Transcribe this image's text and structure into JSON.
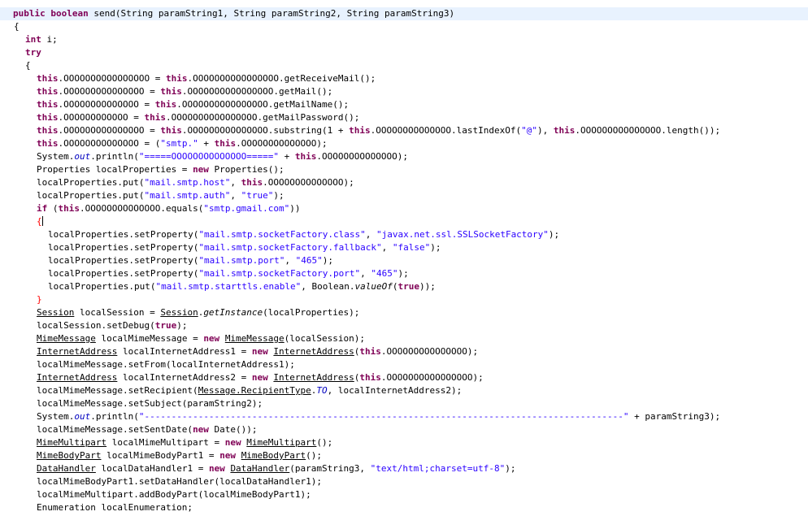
{
  "editor": {
    "lines": [
      [
        {
          "t": "public",
          "c": "kw"
        },
        {
          "t": " "
        },
        {
          "t": "boolean",
          "c": "kw"
        },
        {
          "t": " send(String paramString1, String paramString2, String paramString3)"
        }
      ],
      [
        {
          "t": "{"
        }
      ],
      [
        {
          "t": "int",
          "c": "kw"
        },
        {
          "t": " i;"
        }
      ],
      [
        {
          "t": "try",
          "c": "kw"
        }
      ],
      [
        {
          "t": "{"
        }
      ],
      [
        {
          "t": "this",
          "c": "kw"
        },
        {
          "t": ".OOOOOOOOOOOOOOOO = "
        },
        {
          "t": "this",
          "c": "kw"
        },
        {
          "t": ".OOOOOOOOOOOOOOOO.getReceiveMail();"
        }
      ],
      [
        {
          "t": "this",
          "c": "kw"
        },
        {
          "t": ".OOOOOOOOOOOOOOO = "
        },
        {
          "t": "this",
          "c": "kw"
        },
        {
          "t": ".OOOOOOOOOOOOOOOO.getMail();"
        }
      ],
      [
        {
          "t": "this",
          "c": "kw"
        },
        {
          "t": ".OOOOOOOOOOOOOO = "
        },
        {
          "t": "this",
          "c": "kw"
        },
        {
          "t": ".OOOOOOOOOOOOOOOO.getMailName();"
        }
      ],
      [
        {
          "t": "this",
          "c": "kw"
        },
        {
          "t": ".OOOOOOOOOOOO = "
        },
        {
          "t": "this",
          "c": "kw"
        },
        {
          "t": ".OOOOOOOOOOOOOOOO.getMailPassword();"
        }
      ],
      [
        {
          "t": "this",
          "c": "kw"
        },
        {
          "t": ".OOOOOOOOOOOOOOO = "
        },
        {
          "t": "this",
          "c": "kw"
        },
        {
          "t": ".OOOOOOOOOOOOOOO.substring(1 + "
        },
        {
          "t": "this",
          "c": "kw"
        },
        {
          "t": ".OOOOOOOOOOOOOO.lastIndexOf("
        },
        {
          "t": "\"@\"",
          "c": "str"
        },
        {
          "t": "), "
        },
        {
          "t": "this",
          "c": "kw"
        },
        {
          "t": ".OOOOOOOOOOOOOOO.length());"
        }
      ],
      [
        {
          "t": "this",
          "c": "kw"
        },
        {
          "t": ".OOOOOOOOOOOOOO = ("
        },
        {
          "t": "\"smtp.\"",
          "c": "str"
        },
        {
          "t": " + "
        },
        {
          "t": "this",
          "c": "kw"
        },
        {
          "t": ".OOOOOOOOOOOOOO);"
        }
      ],
      [
        {
          "t": "System."
        },
        {
          "t": "out",
          "c": "fld"
        },
        {
          "t": ".println("
        },
        {
          "t": "\"=====OOOOOOOOOOOOOO=====\"",
          "c": "str"
        },
        {
          "t": " + "
        },
        {
          "t": "this",
          "c": "kw"
        },
        {
          "t": ".OOOOOOOOOOOOOO);"
        }
      ],
      [
        {
          "t": "Properties localProperties = "
        },
        {
          "t": "new",
          "c": "kw"
        },
        {
          "t": " Properties();"
        }
      ],
      [
        {
          "t": "localProperties.put("
        },
        {
          "t": "\"mail.smtp.host\"",
          "c": "str"
        },
        {
          "t": ", "
        },
        {
          "t": "this",
          "c": "kw"
        },
        {
          "t": ".OOOOOOOOOOOOOO);"
        }
      ],
      [
        {
          "t": "localProperties.put("
        },
        {
          "t": "\"mail.smtp.auth\"",
          "c": "str"
        },
        {
          "t": ", "
        },
        {
          "t": "\"true\"",
          "c": "str"
        },
        {
          "t": ");"
        }
      ],
      [
        {
          "t": "if",
          "c": "kw"
        },
        {
          "t": " ("
        },
        {
          "t": "this",
          "c": "kw"
        },
        {
          "t": ".OOOOOOOOOOOOOO.equals("
        },
        {
          "t": "\"smtp.gmail.com\"",
          "c": "str"
        },
        {
          "t": "))"
        }
      ],
      [
        {
          "t": "{",
          "c": "brace-hl"
        },
        {
          "t": "",
          "caret": true
        }
      ],
      [
        {
          "t": "localProperties.setProperty("
        },
        {
          "t": "\"mail.smtp.socketFactory.class\"",
          "c": "str"
        },
        {
          "t": ", "
        },
        {
          "t": "\"javax.net.ssl.SSLSocketFactory\"",
          "c": "str"
        },
        {
          "t": ");"
        }
      ],
      [
        {
          "t": "localProperties.setProperty("
        },
        {
          "t": "\"mail.smtp.socketFactory.fallback\"",
          "c": "str"
        },
        {
          "t": ", "
        },
        {
          "t": "\"false\"",
          "c": "str"
        },
        {
          "t": ");"
        }
      ],
      [
        {
          "t": "localProperties.setProperty("
        },
        {
          "t": "\"mail.smtp.port\"",
          "c": "str"
        },
        {
          "t": ", "
        },
        {
          "t": "\"465\"",
          "c": "str"
        },
        {
          "t": ");"
        }
      ],
      [
        {
          "t": "localProperties.setProperty("
        },
        {
          "t": "\"mail.smtp.socketFactory.port\"",
          "c": "str"
        },
        {
          "t": ", "
        },
        {
          "t": "\"465\"",
          "c": "str"
        },
        {
          "t": ");"
        }
      ],
      [
        {
          "t": "localProperties.put("
        },
        {
          "t": "\"mail.smtp.starttls.enable\"",
          "c": "str"
        },
        {
          "t": ", Boolean."
        },
        {
          "t": "valueOf",
          "c": "it"
        },
        {
          "t": "("
        },
        {
          "t": "true",
          "c": "kw"
        },
        {
          "t": "));"
        }
      ],
      [
        {
          "t": "}",
          "c": "brace-hl"
        }
      ],
      [
        {
          "t": "Session",
          "c": "ul"
        },
        {
          "t": " localSession = "
        },
        {
          "t": "Session",
          "c": "ul"
        },
        {
          "t": "."
        },
        {
          "t": "getInstance",
          "c": "it"
        },
        {
          "t": "(localProperties);"
        }
      ],
      [
        {
          "t": "localSession.setDebug("
        },
        {
          "t": "true",
          "c": "kw"
        },
        {
          "t": ");"
        }
      ],
      [
        {
          "t": "MimeMessage",
          "c": "ul"
        },
        {
          "t": " localMimeMessage = "
        },
        {
          "t": "new",
          "c": "kw"
        },
        {
          "t": " "
        },
        {
          "t": "MimeMessage",
          "c": "ul"
        },
        {
          "t": "(localSession);"
        }
      ],
      [
        {
          "t": "InternetAddress",
          "c": "ul"
        },
        {
          "t": " localInternetAddress1 = "
        },
        {
          "t": "new",
          "c": "kw"
        },
        {
          "t": " "
        },
        {
          "t": "InternetAddress",
          "c": "ul"
        },
        {
          "t": "("
        },
        {
          "t": "this",
          "c": "kw"
        },
        {
          "t": ".OOOOOOOOOOOOOOO);"
        }
      ],
      [
        {
          "t": "localMimeMessage.setFrom(localInternetAddress1);"
        }
      ],
      [
        {
          "t": "InternetAddress",
          "c": "ul"
        },
        {
          "t": " localInternetAddress2 = "
        },
        {
          "t": "new",
          "c": "kw"
        },
        {
          "t": " "
        },
        {
          "t": "InternetAddress",
          "c": "ul"
        },
        {
          "t": "("
        },
        {
          "t": "this",
          "c": "kw"
        },
        {
          "t": ".OOOOOOOOOOOOOOOO);"
        }
      ],
      [
        {
          "t": "localMimeMessage.setRecipient("
        },
        {
          "t": "Message.RecipientType",
          "c": "ul"
        },
        {
          "t": "."
        },
        {
          "t": "TO",
          "c": "fld"
        },
        {
          "t": ", localInternetAddress2);"
        }
      ],
      [
        {
          "t": "localMimeMessage.setSubject(paramString2);"
        }
      ],
      [
        {
          "t": "System."
        },
        {
          "t": "out",
          "c": "fld"
        },
        {
          "t": ".println("
        },
        {
          "t": "\"-----------------------------------------------------------------------------------------\"",
          "c": "str"
        },
        {
          "t": " + paramString3);"
        }
      ],
      [
        {
          "t": "localMimeMessage.setSentDate("
        },
        {
          "t": "new",
          "c": "kw"
        },
        {
          "t": " Date());"
        }
      ],
      [
        {
          "t": "MimeMultipart",
          "c": "ul"
        },
        {
          "t": " localMimeMultipart = "
        },
        {
          "t": "new",
          "c": "kw"
        },
        {
          "t": " "
        },
        {
          "t": "MimeMultipart",
          "c": "ul"
        },
        {
          "t": "();"
        }
      ],
      [
        {
          "t": "MimeBodyPart",
          "c": "ul"
        },
        {
          "t": " localMimeBodyPart1 = "
        },
        {
          "t": "new",
          "c": "kw"
        },
        {
          "t": " "
        },
        {
          "t": "MimeBodyPart",
          "c": "ul"
        },
        {
          "t": "();"
        }
      ],
      [
        {
          "t": "DataHandler",
          "c": "ul"
        },
        {
          "t": " localDataHandler1 = "
        },
        {
          "t": "new",
          "c": "kw"
        },
        {
          "t": " "
        },
        {
          "t": "DataHandler",
          "c": "ul"
        },
        {
          "t": "(paramString3, "
        },
        {
          "t": "\"text/html;charset=utf-8\"",
          "c": "str"
        },
        {
          "t": ");"
        }
      ],
      [
        {
          "t": "localMimeBodyPart1.setDataHandler(localDataHandler1);"
        }
      ],
      [
        {
          "t": "localMimeMultipart.addBodyPart(localMimeBodyPart1);"
        }
      ],
      [
        {
          "t": "Enumeration localEnumeration;"
        }
      ]
    ]
  }
}
